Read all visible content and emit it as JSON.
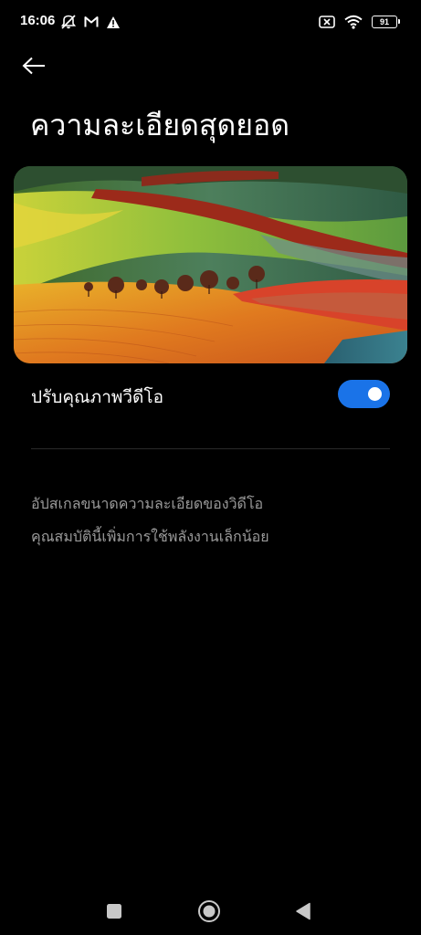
{
  "status_bar": {
    "time": "16:06",
    "battery_level": "91",
    "left_icons": [
      "mute-icon",
      "gmail-icon",
      "warning-icon"
    ],
    "right_icons": [
      "sim-off-icon",
      "wifi-icon",
      "battery-icon"
    ]
  },
  "header": {
    "back_icon": "arrow-left-icon",
    "title": "ความละเอียดสุดยอด"
  },
  "preview": {
    "description": "landscape-photo"
  },
  "setting": {
    "label": "ปรับคุณภาพวีดีโอ",
    "enabled": true,
    "accent_color": "#1a73e8"
  },
  "description": {
    "line1": "อัปสเกลขนาดความละเอียดของวิดีโอ",
    "line2": "คุณสมบัตินี้เพิ่มการใช้พลังงานเล็กน้อย"
  },
  "nav_bar": {
    "icons": [
      "recents-square-icon",
      "home-circle-icon",
      "back-triangle-icon"
    ]
  }
}
